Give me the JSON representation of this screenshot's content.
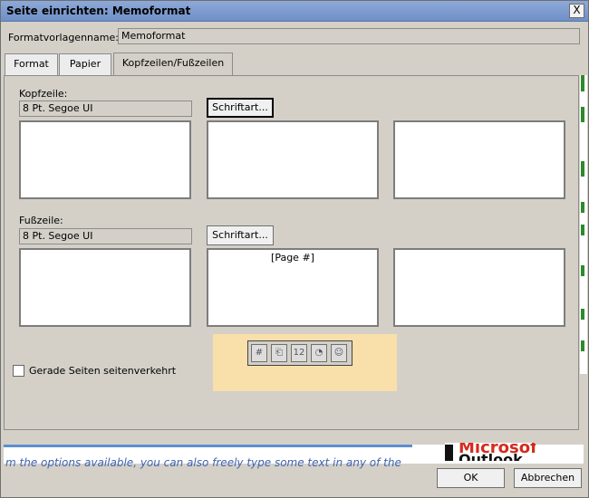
{
  "window": {
    "title": "Seite einrichten: Memoformat",
    "close_label": "X"
  },
  "formatvorlage": {
    "label": "Formatvorlagenname:",
    "value": "Memoformat"
  },
  "tabs": [
    {
      "label": "Format"
    },
    {
      "label": "Papier"
    },
    {
      "label": "Kopfzeilen/Fußzeilen"
    }
  ],
  "header": {
    "label": "Kopfzeile:",
    "font_value": "8 Pt. Segoe UI",
    "font_button": "Schriftart...",
    "boxes": [
      "",
      "",
      ""
    ]
  },
  "footer": {
    "label": "Fußzeile:",
    "font_value": "8 Pt. Segoe UI",
    "font_button": "Schriftart...",
    "boxes": [
      "",
      "[Page #]",
      ""
    ]
  },
  "toolbar": {
    "icons": [
      {
        "name": "page-number-icon",
        "glyph": "#"
      },
      {
        "name": "total-pages-icon",
        "glyph": "⎗"
      },
      {
        "name": "date-icon",
        "glyph": "12"
      },
      {
        "name": "time-icon",
        "glyph": "◔"
      },
      {
        "name": "user-name-icon",
        "glyph": "☺"
      }
    ]
  },
  "options": {
    "reverse_even_pages_label": "Gerade Seiten seitenverkehrt",
    "reverse_even_pages_checked": false
  },
  "background": {
    "text": "m the options available, you can also freely type some text in any of the",
    "logo_line1": "Microsoft",
    "logo_line2": "Outlook"
  },
  "buttons": {
    "ok": "OK",
    "cancel": "Abbrechen"
  },
  "colors": {
    "toolbar_highlight": "#f9dfaa",
    "title_bar": "#7f9bd0"
  }
}
